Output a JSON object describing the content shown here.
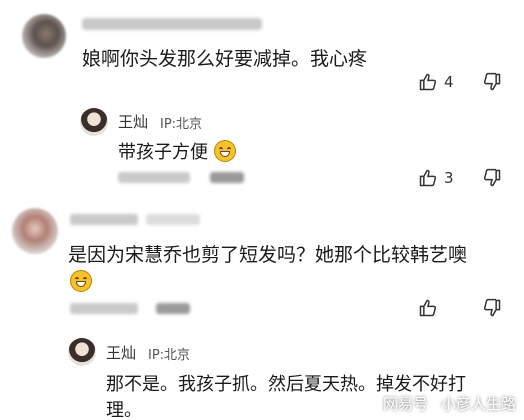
{
  "comments": [
    {
      "text": "娘啊你头发那么好要减掉。我心疼",
      "likes": "4",
      "reply": {
        "username": "王灿",
        "ip": "IP:北京",
        "text": "带孩子方便",
        "likes": "3"
      }
    },
    {
      "text_line1": "是因为宋慧乔也剪了短发吗？她那个比较韩艺噢",
      "reply": {
        "username": "王灿",
        "ip": "IP:北京",
        "text_line1": "那不是。我孩子抓。然后夏天热。掉发不好打",
        "text_line2": "理。"
      }
    }
  ],
  "watermark": {
    "left": "网易号",
    "right": "小彦人生路"
  },
  "colors": {
    "emoji": "#f5c22b",
    "icon": "#333333"
  }
}
